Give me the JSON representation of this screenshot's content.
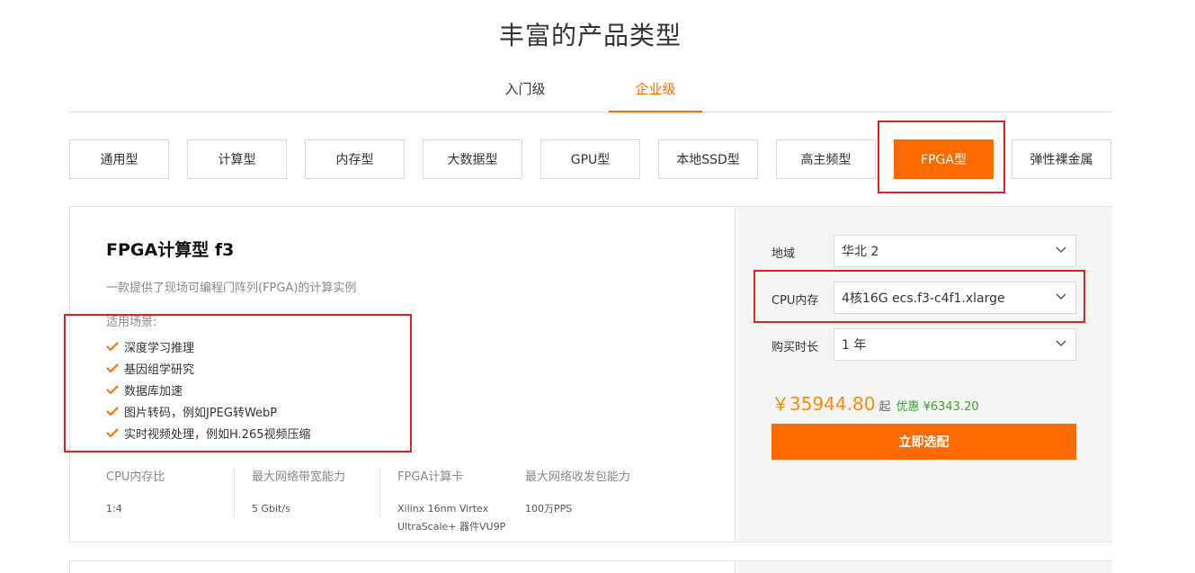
{
  "page_title": "丰富的产品类型",
  "level_tabs": [
    {
      "label": "入门级",
      "active": false
    },
    {
      "label": "企业级",
      "active": true
    }
  ],
  "type_buttons": [
    {
      "label": "通用型",
      "active": false
    },
    {
      "label": "计算型",
      "active": false
    },
    {
      "label": "内存型",
      "active": false
    },
    {
      "label": "大数据型",
      "active": false
    },
    {
      "label": "GPU型",
      "active": false
    },
    {
      "label": "本地SSD型",
      "active": false
    },
    {
      "label": "高主频型",
      "active": false
    },
    {
      "label": "FPGA型",
      "active": true
    },
    {
      "label": "弹性裸金属",
      "active": false
    }
  ],
  "product": {
    "name": "FPGA计算型 f3",
    "description": "一款提供了现场可编程门阵列(FPGA)的计算实例",
    "scenarios_title": "适用场景:",
    "scenarios": [
      "深度学习推理",
      "基因组学研究",
      "数据库加速",
      "图片转码，例如JPEG转WebP",
      "实时视频处理，例如H.265视频压缩"
    ],
    "specs": [
      {
        "label": "CPU内存比",
        "value": "1:4"
      },
      {
        "label": "最大网络带宽能力",
        "value": "5 Gbit/s"
      },
      {
        "label": "FPGA计算卡",
        "value": "Xilinx 16nm Virtex UltraScale+ 器件VU9P"
      },
      {
        "label": "最大网络收发包能力",
        "value": "100万PPS"
      }
    ]
  },
  "config": {
    "region_label": "地域",
    "region_value": "华北 2",
    "cpu_label": "CPU内存",
    "cpu_value": "4核16G ecs.f3-c4f1.xlarge",
    "duration_label": "购买时长",
    "duration_value": "1 年",
    "price": "￥35944.80",
    "price_unit": "起",
    "discount": "优惠 ¥6343.20",
    "buy_label": "立即选配"
  },
  "colors": {
    "accent": "#ff6a00",
    "highlight": "#e02020",
    "discount": "#3aa02f"
  },
  "icons": {
    "check": "check-icon",
    "dropdown": "chevron-down-icon"
  }
}
